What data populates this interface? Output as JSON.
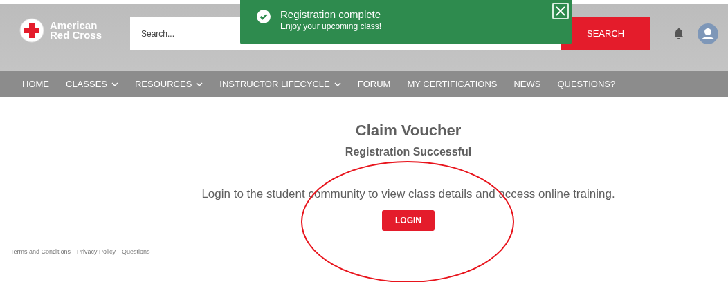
{
  "header": {
    "logo": {
      "line_1": "American",
      "line_2": "Red Cross"
    },
    "search": {
      "placeholder": "Search..."
    },
    "search_button": "SEARCH"
  },
  "toast": {
    "title": "Registration complete",
    "message": "Enjoy your upcoming class!"
  },
  "nav": [
    {
      "label": "HOME",
      "has_menu": false
    },
    {
      "label": "CLASSES",
      "has_menu": true
    },
    {
      "label": "RESOURCES",
      "has_menu": true
    },
    {
      "label": "INSTRUCTOR LIFECYCLE",
      "has_menu": true
    },
    {
      "label": "FORUM",
      "has_menu": false
    },
    {
      "label": "MY CERTIFICATIONS",
      "has_menu": false
    },
    {
      "label": "NEWS",
      "has_menu": false
    },
    {
      "label": "QUESTIONS?",
      "has_menu": false
    }
  ],
  "content": {
    "title": "Claim Voucher",
    "subtitle": "Registration Successful",
    "message": "Login to the student community to view class details and access online training.",
    "button": "LOGIN"
  },
  "footer": {
    "links": [
      "Terms and Conditions",
      "Privacy Policy",
      "Questions"
    ]
  }
}
